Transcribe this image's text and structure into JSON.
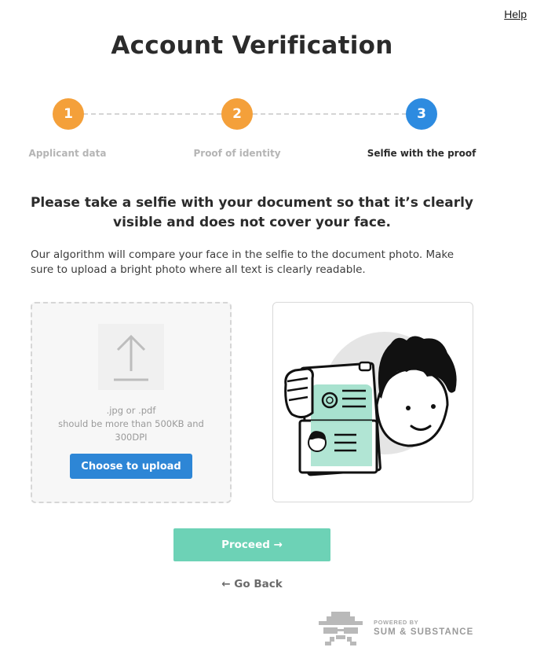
{
  "header": {
    "help_label": "Help",
    "title": "Account Verification"
  },
  "stepper": {
    "steps": [
      {
        "number": "1",
        "label": "Applicant data",
        "state": "completed"
      },
      {
        "number": "2",
        "label": "Proof of identity",
        "state": "completed"
      },
      {
        "number": "3",
        "label": "Selfie with the proof",
        "state": "active"
      }
    ],
    "colors": {
      "completed": "#f4a03a",
      "active": "#2d8be0",
      "inactive_label": "#b5b5b5",
      "active_label": "#2b2b2b"
    }
  },
  "main": {
    "instruction": "Please take a selfie with your document so that it’s clearly visible and does not cover your face.",
    "description": "Our algorithm will compare your face in the selfie to the document photo. Make sure to upload a bright photo where all text is clearly readable."
  },
  "upload": {
    "icon": "upload-arrow-icon",
    "formats": ".jpg or .pdf",
    "requirements": "should be more than 500KB and 300DPI",
    "button_label": "Choose to upload"
  },
  "illustration": {
    "icon": "selfie-with-document-illustration",
    "accent": "#a8e2cf"
  },
  "actions": {
    "proceed_label": "Proceed →",
    "back_label": "← Go Back",
    "proceed_color": "#6dd2b6"
  },
  "footer": {
    "powered_by": "POWERED BY",
    "brand": "SUM & SUBSTANCE",
    "logo_icon": "spy-logo-icon"
  }
}
